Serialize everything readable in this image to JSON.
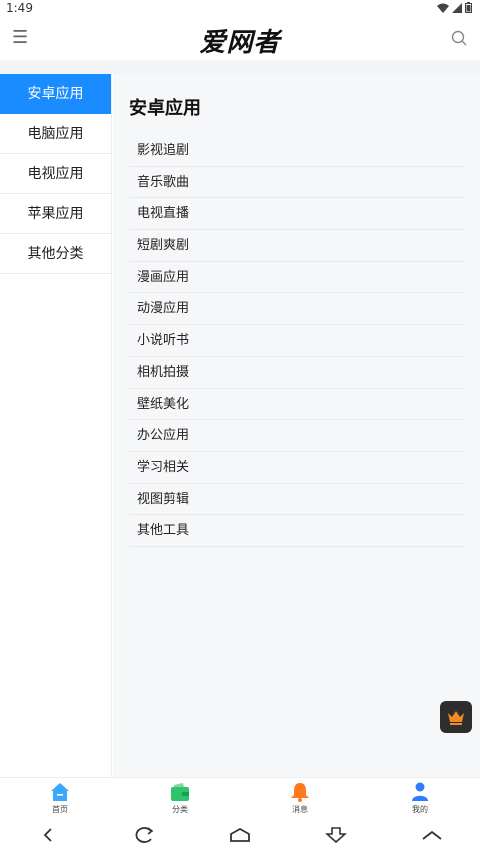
{
  "status": {
    "time": "1:49"
  },
  "header": {
    "logo_text": "爱网者"
  },
  "sidebar": {
    "items": [
      {
        "label": "安卓应用",
        "active": true
      },
      {
        "label": "电脑应用",
        "active": false
      },
      {
        "label": "电视应用",
        "active": false
      },
      {
        "label": "苹果应用",
        "active": false
      },
      {
        "label": "其他分类",
        "active": false
      }
    ]
  },
  "main": {
    "title": "安卓应用",
    "items": [
      "影视追剧",
      "音乐歌曲",
      "电视直播",
      "短剧爽剧",
      "漫画应用",
      "动漫应用",
      "小说听书",
      "相机拍摄",
      "壁纸美化",
      "办公应用",
      "学习相关",
      "视图剪辑",
      "其他工具"
    ]
  },
  "tabbar": {
    "tabs": [
      {
        "label": "首页",
        "icon": "home-icon",
        "color": "#3aa7ff"
      },
      {
        "label": "分类",
        "icon": "wallet-icon",
        "color": "#2ec46b"
      },
      {
        "label": "消息",
        "icon": "bell-icon",
        "color": "#ff7a1a"
      },
      {
        "label": "我的",
        "icon": "user-icon",
        "color": "#2f7bff"
      }
    ]
  },
  "colors": {
    "accent": "#1a8cff",
    "float_button_icon": "#f08a24"
  }
}
